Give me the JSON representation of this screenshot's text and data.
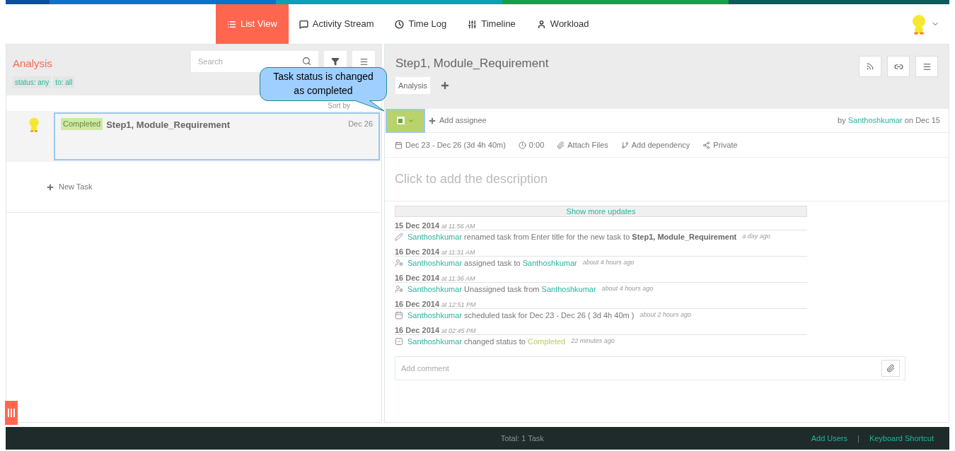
{
  "nav": {
    "tabs": [
      {
        "label": "List View",
        "selected": true
      },
      {
        "label": "Activity Stream",
        "selected": false
      },
      {
        "label": "Time Log",
        "selected": false
      },
      {
        "label": "Timeline",
        "selected": false
      },
      {
        "label": "Workload",
        "selected": false
      }
    ]
  },
  "list_panel": {
    "title": "Analysis",
    "search": {
      "placeholder": "Search"
    },
    "filters": [
      "status: any",
      "to: all"
    ],
    "sort_label": "Sort by",
    "tasks": [
      {
        "status": "Completed",
        "title": "Step1, Module_Requirement",
        "date": "Dec 26",
        "selected": true
      }
    ],
    "new_task": "New Task"
  },
  "callout": {
    "text": "Task status is changed as completed"
  },
  "task_detail": {
    "title": "Step1, Module_Requirement",
    "tags": [
      "Analysis"
    ],
    "completed": true,
    "add_assignee": "Add assignee",
    "by_prefix": "by",
    "author": "Santhoshkumar",
    "on_date": "on Dec 15",
    "meta": [
      "Dec 23 - Dec 26 (3d 4h 40m)",
      "0:00",
      "Attach Files",
      "Add dependency",
      "Private"
    ],
    "description_placeholder": "Click to add the description",
    "show_more": "Show more updates",
    "updates": [
      {
        "date": "15 Dec 2014",
        "time": "at 11:56 AM",
        "parts": [
          {
            "kind": "user",
            "text": "Santhoshkumar"
          },
          {
            "kind": "text",
            "text": "renamed task from Enter title for the new task to"
          },
          {
            "kind": "bold",
            "text": "Step1, Module_Requirement"
          }
        ],
        "ago": "a day ago"
      },
      {
        "date": "16 Dec 2014",
        "time": "at 11:31 AM",
        "parts": [
          {
            "kind": "user",
            "text": "Santhoshkumar"
          },
          {
            "kind": "text",
            "text": "assigned task to"
          },
          {
            "kind": "user",
            "text": "Santhoshkumar"
          }
        ],
        "ago": "about 4 hours ago"
      },
      {
        "date": "16 Dec 2014",
        "time": "at 11:36 AM",
        "parts": [
          {
            "kind": "user",
            "text": "Santhoshkumar"
          },
          {
            "kind": "text",
            "text": "Unassigned task from"
          },
          {
            "kind": "user",
            "text": "Santhoshkumar"
          }
        ],
        "ago": "about 4 hours ago"
      },
      {
        "date": "16 Dec 2014",
        "time": "at 12:51 PM",
        "parts": [
          {
            "kind": "user",
            "text": "Santhoshkumar"
          },
          {
            "kind": "text",
            "text": "scheduled task for Dec 23 - Dec 26 ( 3d 4h 40m )"
          }
        ],
        "ago": "about 2 hours ago"
      },
      {
        "date": "16 Dec 2014",
        "time": "at 02:45 PM",
        "parts": [
          {
            "kind": "user",
            "text": "Santhoshkumar"
          },
          {
            "kind": "text",
            "text": "changed status to"
          },
          {
            "kind": "status",
            "text": "Completed"
          }
        ],
        "ago": "22 minutes ago"
      }
    ],
    "comment": {
      "placeholder": "Add comment"
    }
  },
  "footer": {
    "total": "Total: 1 Task",
    "links": [
      "Add Users",
      "Keyboard Shortcut"
    ],
    "separator": "|"
  }
}
